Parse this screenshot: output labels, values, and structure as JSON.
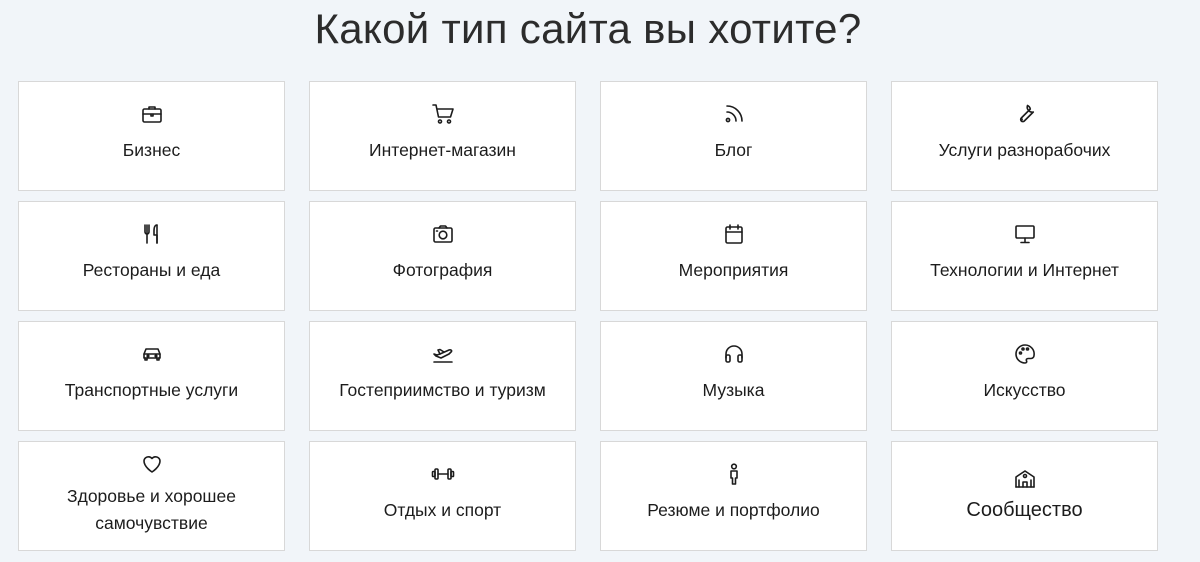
{
  "page": {
    "title": "Какой тип сайта вы хотите?"
  },
  "categories": [
    {
      "label": "Бизнес",
      "icon": "briefcase-icon"
    },
    {
      "label": "Интернет-магазин",
      "icon": "shopping-cart-icon"
    },
    {
      "label": "Блог",
      "icon": "rss-icon"
    },
    {
      "label": "Услуги разнорабочих",
      "icon": "wrench-icon"
    },
    {
      "label": "Рестораны и еда",
      "icon": "utensils-icon"
    },
    {
      "label": "Фотография",
      "icon": "camera-icon"
    },
    {
      "label": "Мероприятия",
      "icon": "calendar-icon"
    },
    {
      "label": "Технологии и Интернет",
      "icon": "monitor-icon"
    },
    {
      "label": "Транспортные услуги",
      "icon": "car-icon"
    },
    {
      "label": "Гостеприимство и туризм",
      "icon": "airplane-icon"
    },
    {
      "label": "Музыка",
      "icon": "headphones-icon"
    },
    {
      "label": "Искусство",
      "icon": "palette-icon"
    },
    {
      "label": "Здоровье и хорошее самочувствие",
      "icon": "heart-icon"
    },
    {
      "label": "Отдых и спорт",
      "icon": "dumbbell-icon"
    },
    {
      "label": "Резюме и портфолио",
      "icon": "person-icon"
    },
    {
      "label": "Сообщество",
      "icon": "community-building-icon"
    }
  ]
}
